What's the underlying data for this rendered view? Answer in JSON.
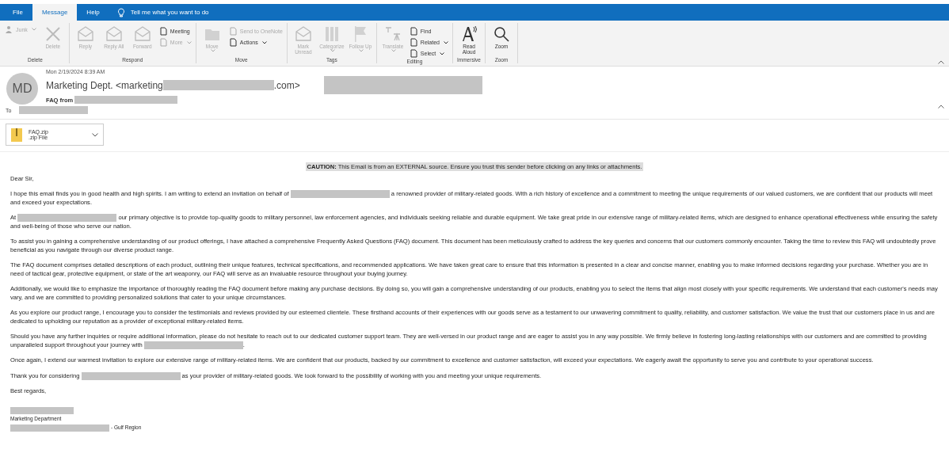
{
  "tabs": [
    {
      "label": "File",
      "selected": false
    },
    {
      "label": "Message",
      "selected": true
    },
    {
      "label": "Help",
      "selected": false
    }
  ],
  "tell_me": {
    "placeholder": "Tell me what you want to do"
  },
  "ribbon_groups": [
    {
      "label": "Delete",
      "items": [
        {
          "kind": "small",
          "label": "Junk",
          "dropdown": true,
          "disabled": true
        },
        {
          "kind": "large",
          "label": "Delete",
          "disabled": true
        }
      ]
    },
    {
      "label": "Respond",
      "items": [
        {
          "kind": "large",
          "label": "Reply",
          "disabled": true
        },
        {
          "kind": "large",
          "label": "Reply All",
          "disabled": true
        },
        {
          "kind": "large",
          "label": "Forward",
          "disabled": true
        },
        {
          "kind": "stack",
          "children": [
            {
              "label": "Meeting",
              "dropdown": false,
              "disabled": false
            },
            {
              "label": "More",
              "dropdown": true,
              "disabled": true
            }
          ]
        }
      ]
    },
    {
      "label": "Move",
      "items": [
        {
          "kind": "large",
          "label": "Move",
          "dropdown": true,
          "disabled": true
        },
        {
          "kind": "stack",
          "children": [
            {
              "label": "Send to OneNote",
              "dropdown": false,
              "disabled": true
            },
            {
              "label": "Actions",
              "dropdown": true,
              "disabled": false
            }
          ]
        }
      ]
    },
    {
      "label": "Tags",
      "items": [
        {
          "kind": "large",
          "label": "Mark Unread",
          "disabled": true
        },
        {
          "kind": "large",
          "label": "Categorize",
          "dropdown": true,
          "disabled": true
        },
        {
          "kind": "large",
          "label": "Follow Up",
          "dropdown": true,
          "disabled": true
        }
      ]
    },
    {
      "label": "Editing",
      "items": [
        {
          "kind": "large",
          "label": "Translate",
          "dropdown": true,
          "disabled": true
        },
        {
          "kind": "stack",
          "children": [
            {
              "label": "Find",
              "dropdown": false,
              "disabled": false
            },
            {
              "label": "Related",
              "dropdown": true,
              "disabled": false
            },
            {
              "label": "Select",
              "dropdown": true,
              "disabled": false
            }
          ]
        }
      ]
    },
    {
      "label": "Immersive",
      "items": [
        {
          "kind": "large",
          "label": "Read Aloud",
          "disabled": false
        }
      ]
    },
    {
      "label": "Zoom",
      "items": [
        {
          "kind": "large",
          "label": "Zoom",
          "disabled": false
        }
      ]
    }
  ],
  "email": {
    "avatar": "MD",
    "date": "Mon 2/19/2024 8:39 AM",
    "from_prefix": "Marketing Dept. <marketing",
    "from_suffix": ".com>",
    "subject": "FAQ from",
    "to_label": "To",
    "attachment": {
      "name": "FAQ.zip",
      "type": ".zip File"
    },
    "caution": "**CAUTION:** This Email is from an EXTERNAL source. Ensure you trust this sender before clicking on any links or attachments.",
    "greeting": "Dear Sir,",
    "paragraphs": [
      [
        {
          "kind": "text",
          "text": "I hope this email finds you in good health and high spirits. I am writing to extend an invitation on behalf of "
        },
        {
          "kind": "redacted"
        },
        {
          "kind": "text",
          "text": " a renowned provider of military-related goods. With a rich history of excellence and a commitment to meeting the unique requirements of our valued customers, we are confident that our products will meet and exceed your expectations."
        }
      ],
      [
        {
          "kind": "text",
          "text": "At "
        },
        {
          "kind": "redacted"
        },
        {
          "kind": "text",
          "text": " our primary objective is to provide top-quality goods to military personnel, law enforcement agencies, and individuals seeking reliable and durable equipment. We take great pride in our extensive range of military-related items, which are designed to enhance operational effectiveness while ensuring the safety and well-being of those who serve our nation."
        }
      ],
      [
        {
          "kind": "text",
          "text": "To assist you in gaining a comprehensive understanding of our product offerings, I have attached a comprehensive Frequently Asked Questions (FAQ) document. This document has been meticulously crafted to address the key queries and concerns that our customers commonly encounter. Taking the time to review this FAQ will undoubtedly prove beneficial as you navigate through our diverse product range."
        }
      ],
      [
        {
          "kind": "text",
          "text": "The FAQ document comprises detailed descriptions of each product, outlining their unique features, technical specifications, and recommended applications. We have taken great care to ensure that this information is presented in a clear and concise manner, enabling you to make informed decisions regarding your purchase. Whether you are in need of tactical gear, protective equipment, or state of the art weaponry, our FAQ will serve as an invaluable resource throughout your buying journey."
        }
      ],
      [
        {
          "kind": "text",
          "text": "Additionally, we would like to emphasize the importance of thoroughly reading the FAQ document before making any purchase decisions. By doing so, you will gain a comprehensive understanding of our products, enabling you to select the items that align most closely with your specific requirements. We understand that each customer's needs may vary, and we are committed to providing personalized solutions that cater to your unique circumstances."
        }
      ],
      [
        {
          "kind": "text",
          "text": "As you explore our product range, I encourage you to consider the testimonials and reviews provided by our esteemed clientele. These firsthand accounts of their experiences with our goods serve as a testament to our unwavering commitment to quality, reliability, and customer satisfaction. We value the trust that our customers place in us and are dedicated to upholding our reputation as a provider of exceptional military-related items."
        }
      ],
      [
        {
          "kind": "text",
          "text": "Should you have any further inquiries or require additional information, please do not hesitate to reach out to our dedicated customer support team. They are well-versed in our product range and are eager to assist you in any way possible. We firmly believe in fostering long-lasting relationships with our customers and are committed to providing unparalleled support throughout your journey with "
        },
        {
          "kind": "redacted"
        },
        {
          "kind": "text",
          "text": "."
        }
      ],
      [
        {
          "kind": "text",
          "text": "Once again, I extend our warmest invitation to explore our extensive range of military-related items. We are confident that our products, backed by our commitment to excellence and customer satisfaction, will exceed your expectations. We eagerly await the opportunity to serve you and contribute to your operational success."
        }
      ],
      [
        {
          "kind": "text",
          "text": "Thank you for considering "
        },
        {
          "kind": "redacted"
        },
        {
          "kind": "text",
          "text": " as your provider of military-related goods. We look forward to the possibility of working with you and meeting your unique requirements."
        }
      ]
    ],
    "closing": "Best regards,",
    "signature": {
      "department": "Marketing Department",
      "region": "- Gulf Region"
    }
  }
}
